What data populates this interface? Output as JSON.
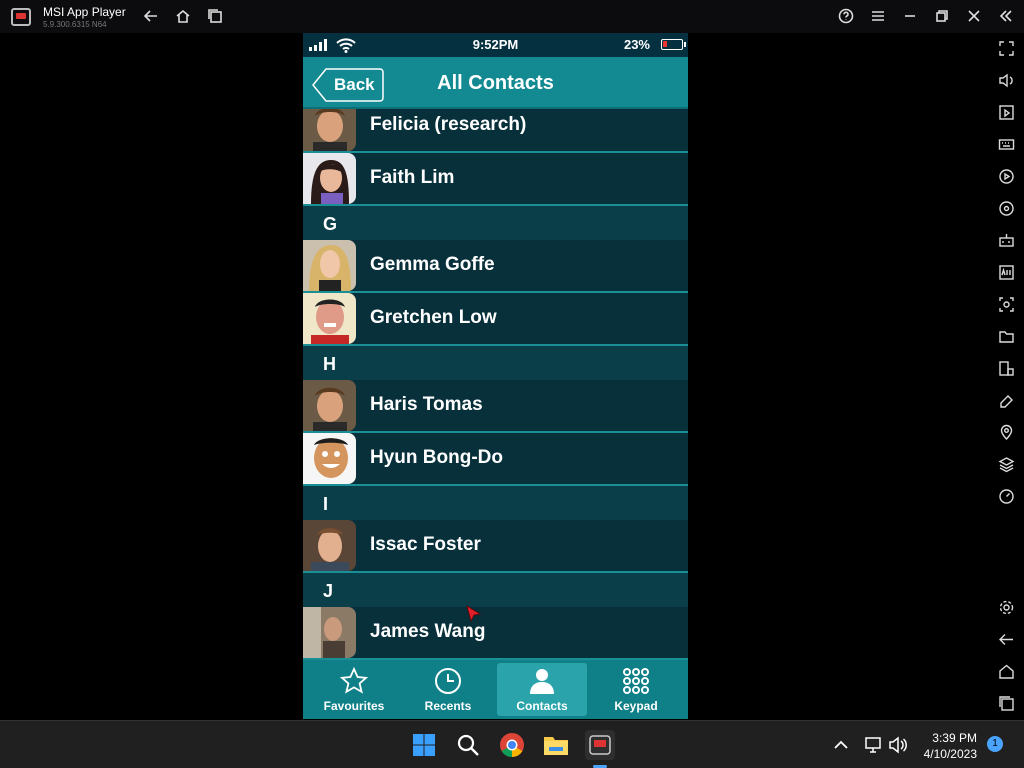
{
  "window": {
    "title": "MSI App Player",
    "version": "5.9.300.6315 N64"
  },
  "phone": {
    "status": {
      "time": "9:52PM",
      "battery": "23%"
    },
    "header": {
      "back_label": "Back",
      "title": "All Contacts"
    },
    "contacts": [
      {
        "type": "contact",
        "name": "Felicia (research)",
        "avatar": "male-brown-hair"
      },
      {
        "type": "contact",
        "name": "Faith Lim",
        "avatar": "female-dark-hair"
      },
      {
        "type": "section",
        "letter": "G"
      },
      {
        "type": "contact",
        "name": "Gemma Goffe",
        "avatar": "female-blonde"
      },
      {
        "type": "contact",
        "name": "Gretchen Low",
        "avatar": "male-red-shirt"
      },
      {
        "type": "section",
        "letter": "H"
      },
      {
        "type": "contact",
        "name": "Haris Tomas",
        "avatar": "male-brown-hair"
      },
      {
        "type": "contact",
        "name": "Hyun Bong-Do",
        "avatar": "male-smiling"
      },
      {
        "type": "section",
        "letter": "I"
      },
      {
        "type": "contact",
        "name": "Issac Foster",
        "avatar": "male-short-hair"
      },
      {
        "type": "section",
        "letter": "J"
      },
      {
        "type": "contact",
        "name": "James Wang",
        "avatar": "person-in-room"
      }
    ],
    "tabs": [
      {
        "label": "Favourites",
        "icon": "star-icon",
        "active": false
      },
      {
        "label": "Recents",
        "icon": "clock-icon",
        "active": false
      },
      {
        "label": "Contacts",
        "icon": "person-icon",
        "active": true
      },
      {
        "label": "Keypad",
        "icon": "keypad-icon",
        "active": false
      }
    ]
  },
  "taskbar": {
    "time": "3:39 PM",
    "date": "4/10/2023",
    "notification_count": "1"
  },
  "colors": {
    "header": "#138a92",
    "list_bg": "#08303b",
    "row_divider": "#1a8f95",
    "tabbar": "#0f7f88"
  }
}
